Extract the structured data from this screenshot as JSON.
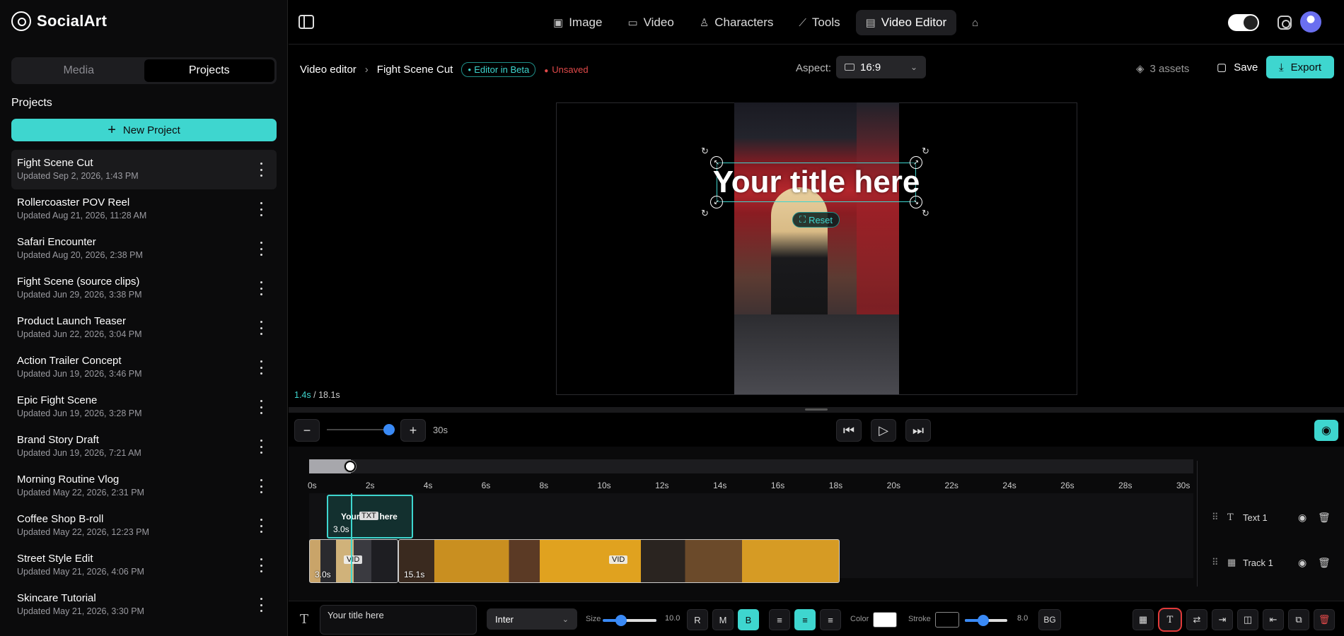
{
  "brand": {
    "name": "SocialArt"
  },
  "sidebar": {
    "tabs": [
      "Media",
      "Projects"
    ],
    "active_tab": "Projects",
    "section_title": "Projects",
    "new_project_label": "New Project",
    "projects": [
      {
        "name": "Fight Scene Cut",
        "updated": "Updated Sep 2, 2026, 1:43 PM"
      },
      {
        "name": "Rollercoaster POV Reel",
        "updated": "Updated Aug 21, 2026, 11:28 AM"
      },
      {
        "name": "Safari Encounter",
        "updated": "Updated Aug 20, 2026, 2:38 PM"
      },
      {
        "name": "Fight Scene (source clips)",
        "updated": "Updated Jun 29, 2026, 3:38 PM"
      },
      {
        "name": "Product Launch Teaser",
        "updated": "Updated Jun 22, 2026, 3:04 PM"
      },
      {
        "name": "Action Trailer Concept",
        "updated": "Updated Jun 19, 2026, 3:46 PM"
      },
      {
        "name": "Epic Fight Scene",
        "updated": "Updated Jun 19, 2026, 3:28 PM"
      },
      {
        "name": "Brand Story Draft",
        "updated": "Updated Jun 19, 2026, 7:21 AM"
      },
      {
        "name": "Morning Routine Vlog",
        "updated": "Updated May 22, 2026, 2:31 PM"
      },
      {
        "name": "Coffee Shop B-roll",
        "updated": "Updated May 22, 2026, 12:23 PM"
      },
      {
        "name": "Street Style Edit",
        "updated": "Updated May 21, 2026, 4:06 PM"
      },
      {
        "name": "Skincare Tutorial",
        "updated": "Updated May 21, 2026, 3:30 PM"
      }
    ]
  },
  "nav": {
    "items": [
      {
        "label": "Image",
        "icon": "image-icon"
      },
      {
        "label": "Video",
        "icon": "video-icon"
      },
      {
        "label": "Characters",
        "icon": "person-icon"
      },
      {
        "label": "Tools",
        "icon": "wand-icon"
      },
      {
        "label": "Video Editor",
        "icon": "clapper-icon"
      }
    ],
    "active": "Video Editor"
  },
  "editor": {
    "breadcrumb_root": "Video editor",
    "project_name": "Fight Scene Cut",
    "beta_badge": "Editor in Beta",
    "status": "Unsaved",
    "aspect_label": "Aspect:",
    "aspect_value": "16:9",
    "assets": "3 assets",
    "save_label": "Save",
    "export_label": "Export",
    "overlay_title": "Your title here",
    "reset_label": "Reset",
    "current_time": "1.4s",
    "total_time": "/ 18.1s"
  },
  "transport": {
    "zoom_value": "30s"
  },
  "timeline": {
    "ticks": [
      "0s",
      "2s",
      "4s",
      "6s",
      "8s",
      "10s",
      "12s",
      "14s",
      "16s",
      "18s",
      "20s",
      "22s",
      "24s",
      "26s",
      "28s",
      "30s"
    ],
    "playhead_s": 1.4,
    "text_clip": {
      "label": "Your title here",
      "tag": "TXT",
      "duration": "3.0s"
    },
    "video_clips": [
      {
        "tag": "VID",
        "duration": "3.0s"
      },
      {
        "tag": "VID",
        "duration": "15.1s"
      }
    ],
    "tracks": [
      {
        "name": "Text 1",
        "icon": "text-icon"
      },
      {
        "name": "Track 1",
        "icon": "film-icon"
      }
    ]
  },
  "text_toolbar": {
    "text_value": "Your title here",
    "font": "Inter",
    "size_label": "Size",
    "size_value": "10.0",
    "weights": [
      "R",
      "M",
      "B"
    ],
    "active_weight": "B",
    "align_active": "center",
    "color_label": "Color",
    "color_value": "#ffffff",
    "stroke_label": "Stroke",
    "stroke_color": "#000000",
    "stroke_value": "8.0",
    "bg_label": "BG"
  },
  "colors": {
    "accent": "#3ed6cf",
    "danger": "#e24a4a",
    "slider": "#3a8af6"
  }
}
